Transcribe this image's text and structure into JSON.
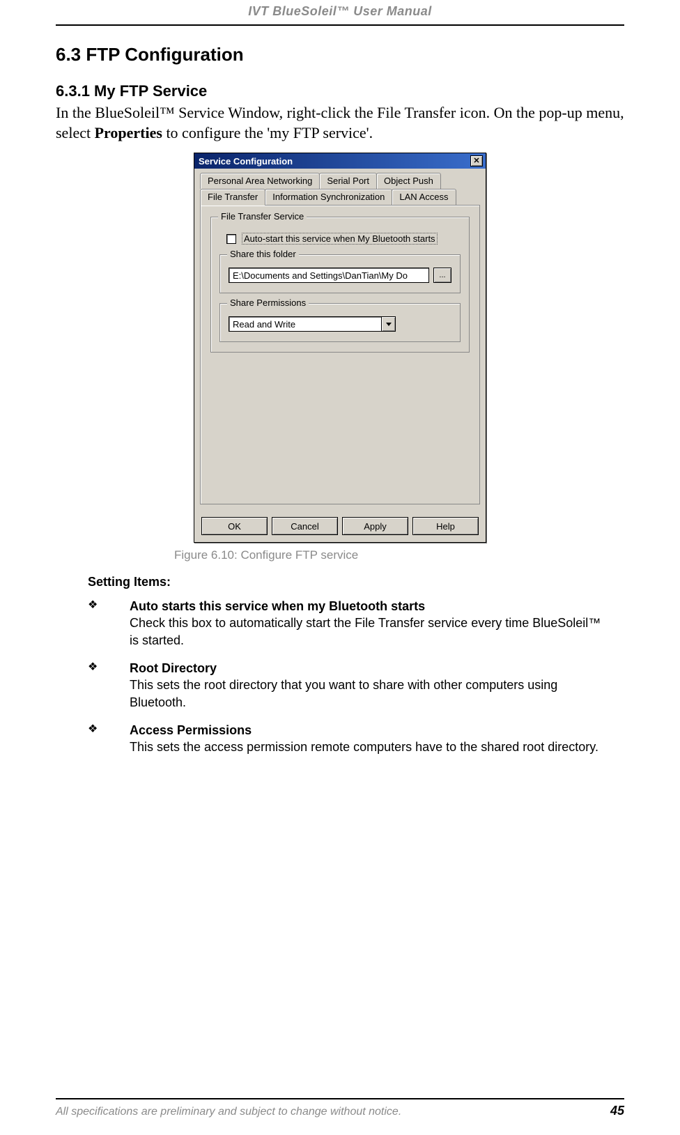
{
  "header": {
    "title": "IVT BlueSoleil™ User Manual"
  },
  "section": {
    "h1": "6.3  FTP Configuration",
    "h2": "6.3.1 My FTP Service",
    "intro_a": "In the BlueSoleil™ Service Window, right-click the File Transfer icon. On the pop-up menu, select ",
    "intro_strong": "Properties",
    "intro_b": " to configure the 'my FTP service'."
  },
  "dialog": {
    "title": "Service Configuration",
    "close_glyph": "✕",
    "tabs_row1": [
      "Personal Area Networking",
      "Serial Port",
      "Object Push"
    ],
    "tabs_row2": [
      "File Transfer",
      "Information Synchronization",
      "LAN Access"
    ],
    "group_main": "File Transfer Service",
    "autostart_label": "Auto-start this service when My Bluetooth starts",
    "share_folder_label": "Share this folder",
    "share_folder_value": "E:\\Documents and Settings\\DanTian\\My Do",
    "browse_label": "...",
    "share_perm_label": "Share Permissions",
    "share_perm_value": "Read and Write",
    "buttons": {
      "ok": "OK",
      "cancel": "Cancel",
      "apply": "Apply",
      "help": "Help"
    }
  },
  "caption": "Figure 6.10: Configure FTP service",
  "settings": {
    "heading": "Setting Items:",
    "items": [
      {
        "title": "Auto starts this service when my Bluetooth starts",
        "body": "Check this box to automatically start the File Transfer service every time BlueSoleil™ is started."
      },
      {
        "title": "Root Directory",
        "body": "This sets the root directory that you want to share with other computers using Bluetooth."
      },
      {
        "title": "Access Permissions",
        "body": "This sets the access permission remote computers have to the shared root directory."
      }
    ],
    "bullet": "❖"
  },
  "footer": {
    "note": "All specifications are preliminary and subject to change without notice.",
    "page": "45"
  }
}
